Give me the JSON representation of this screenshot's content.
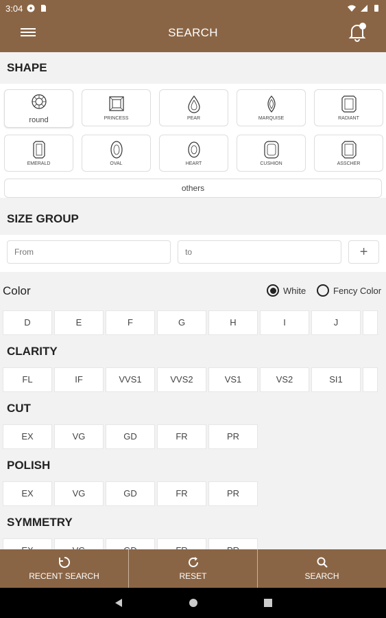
{
  "status": {
    "time": "3:04"
  },
  "appbar": {
    "title": "SEARCH"
  },
  "shape": {
    "heading": "SHAPE",
    "items": [
      {
        "label": "round",
        "icon": "round-diamond-icon"
      },
      {
        "label": "PRINCESS",
        "icon": "princess-diamond-icon"
      },
      {
        "label": "PEAR",
        "icon": "pear-diamond-icon"
      },
      {
        "label": "MARQUISE",
        "icon": "marquise-diamond-icon"
      },
      {
        "label": "RADIANT",
        "icon": "radiant-diamond-icon"
      },
      {
        "label": "EMERALD",
        "icon": "emerald-diamond-icon"
      },
      {
        "label": "OVAL",
        "icon": "oval-diamond-icon"
      },
      {
        "label": "HEART",
        "icon": "heart-diamond-icon"
      },
      {
        "label": "CUSHION",
        "icon": "cushion-diamond-icon"
      },
      {
        "label": "ASSCHER",
        "icon": "asscher-diamond-icon"
      }
    ],
    "others": "others"
  },
  "size_group": {
    "heading": "SIZE GROUP",
    "from_placeholder": "From",
    "to_placeholder": "to",
    "add": "+"
  },
  "color": {
    "heading": "Color",
    "white": "White",
    "fancy": "Fency Color",
    "selected": "White",
    "options": [
      "D",
      "E",
      "F",
      "G",
      "H",
      "I",
      "J",
      ""
    ]
  },
  "clarity": {
    "heading": "CLARITY",
    "options": [
      "FL",
      "IF",
      "VVS1",
      "VVS2",
      "VS1",
      "VS2",
      "SI1",
      ""
    ]
  },
  "cut": {
    "heading": "CUT",
    "options": [
      "EX",
      "VG",
      "GD",
      "FR",
      "PR"
    ]
  },
  "polish": {
    "heading": "POLISH",
    "options": [
      "EX",
      "VG",
      "GD",
      "FR",
      "PR"
    ]
  },
  "symmetry": {
    "heading": "SYMMETRY",
    "options": [
      "EX",
      "VG",
      "GD",
      "FR",
      "PR"
    ]
  },
  "bottom": {
    "recent": "RECENT SEARCH",
    "reset": "RESET",
    "search": "SEARCH"
  },
  "colors": {
    "brand": "#8a6545",
    "background": "#f2f2f2"
  }
}
